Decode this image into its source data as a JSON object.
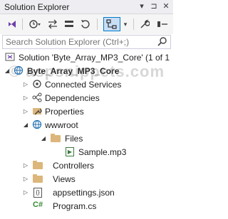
{
  "window": {
    "title": "Solution Explorer"
  },
  "title_controls": {
    "pin": "▾",
    "autohide": "⊐",
    "close": "✕"
  },
  "toolbar": {
    "icons": [
      "vs-icon",
      "history-icon",
      "sync-icon",
      "split-icon",
      "refresh-icon",
      "show-files-icon",
      "wrench-icon",
      "collapse-icon"
    ]
  },
  "search": {
    "placeholder": "Search Solution Explorer (Ctrl+;)"
  },
  "watermark": "© aspsnippets.com",
  "tree": {
    "solution": "Solution 'Byte_Array_MP3_Core' (1 of 1",
    "project": "Byte_Array_MP3_Core",
    "connected_services": "Connected Services",
    "dependencies": "Dependencies",
    "properties": "Properties",
    "wwwroot": "wwwroot",
    "files": "Files",
    "sample": "Sample.mp3",
    "controllers": "Controllers",
    "views": "Views",
    "appsettings": "appsettings.json",
    "program": "Program.cs",
    "cs_badge": "C#"
  },
  "colors": {
    "accent": "#007acc",
    "folder": "#dcb67a",
    "titlebar": "#eeeef2"
  }
}
